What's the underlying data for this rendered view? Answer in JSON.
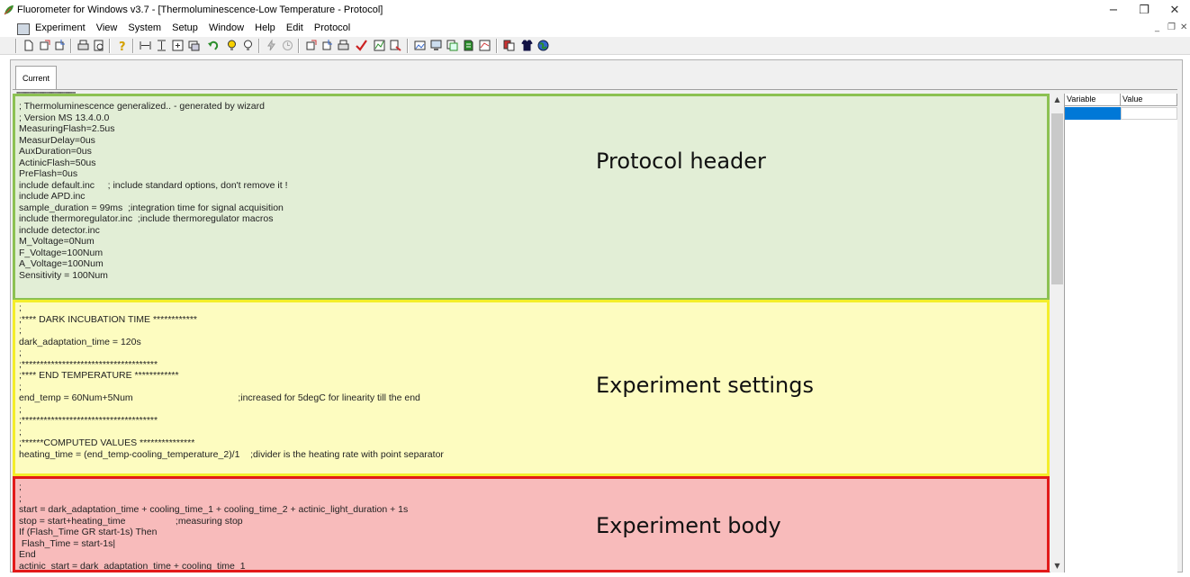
{
  "window": {
    "title": "Fluorometer for Windows v3.7 - [Thermoluminescence-Low Temperature - Protocol]",
    "minimize": "−",
    "restore": "❐",
    "close": "✕"
  },
  "menu": {
    "items": [
      "Experiment",
      "View",
      "System",
      "Setup",
      "Window",
      "Help",
      "Edit",
      "Protocol"
    ],
    "mdi_min": "_",
    "mdi_restore": "❐",
    "mdi_close": "✕"
  },
  "toolbar": {
    "icons": [
      "new-icon",
      "open-icon",
      "save-icon",
      "print-icon",
      "print-preview-icon",
      "help-icon",
      "fit-icon",
      "align-icon",
      "zoom-icon",
      "window-icon",
      "undo-icon",
      "bulb-on-icon",
      "bulb-off-icon",
      "flash-icon",
      "clock-icon",
      "open-protocol-icon",
      "save-protocol-icon",
      "print-protocol-icon",
      "check-icon",
      "chart-icon",
      "export-icon",
      "image-icon",
      "monitor-icon",
      "copy-icon",
      "document-icon",
      "graph-icon",
      "compare-icon",
      "shirt-icon",
      "globe-icon"
    ]
  },
  "tabs": {
    "current": "Current"
  },
  "editor": {
    "top_dots": "''''''''''''''''''''''''''''''''''''''''''''''''''''''''''''''''''''''''''''''''''''''''''''''''''''''''''''''''''''''''''''",
    "header": {
      "label": "Protocol header",
      "lines": [
        "; Thermoluminescence generalized.. - generated by wizard",
        "; Version MS 13.4.0.0",
        "MeasuringFlash=2.5us",
        "MeasurDelay=0us",
        "AuxDuration=0us",
        "ActinicFlash=50us",
        "PreFlash=0us",
        "include default.inc     ; include standard options, don't remove it !",
        "include APD.inc",
        "sample_duration = 99ms  ;integration time for signal acquisition",
        "include thermoregulator.inc  ;include thermoregulator macros",
        "include detector.inc",
        "M_Voltage=0Num",
        "F_Voltage=100Num",
        "A_Voltage=100Num",
        "Sensitivity = 100Num"
      ]
    },
    "settings": {
      "label": "Experiment settings",
      "lines": [
        ";",
        ";**** DARK INCUBATION TIME ************",
        ";",
        "dark_adaptation_time = 120s",
        ";",
        ";*************************************",
        ";**** END TEMPERATURE ************",
        ";",
        "end_temp = 60Num+5Num                                        ;increased for 5degC for linearity till the end",
        ";",
        ";*************************************",
        ";",
        ";******COMPUTED VALUES ***************",
        "heating_time = (end_temp-cooling_temperature_2)/1    ;divider is the heating rate with point separator"
      ]
    },
    "body": {
      "label": "Experiment body",
      "lines": [
        ";",
        ";",
        "start = dark_adaptation_time + cooling_time_1 + cooling_time_2 + actinic_light_duration + 1s",
        "stop = start+heating_time                   ;measuring stop",
        "If (Flash_Time GR start-1s) Then",
        " Flash_Time = start-1s|",
        "End",
        "actinic_start = dark_adaptation_time + cooling_time_1"
      ]
    }
  },
  "scrollbar": {
    "up": "▲",
    "down": "▼"
  },
  "variables": {
    "headers": [
      "Variable",
      "Value"
    ]
  },
  "colors": {
    "header_border": "#8cc152",
    "header_fill": "#e2eed6",
    "settings_border": "#f4ee2a",
    "settings_fill": "#fdfcc0",
    "body_border": "#e21a1a",
    "body_fill": "#f8bbbb",
    "selection": "#0078d7"
  }
}
